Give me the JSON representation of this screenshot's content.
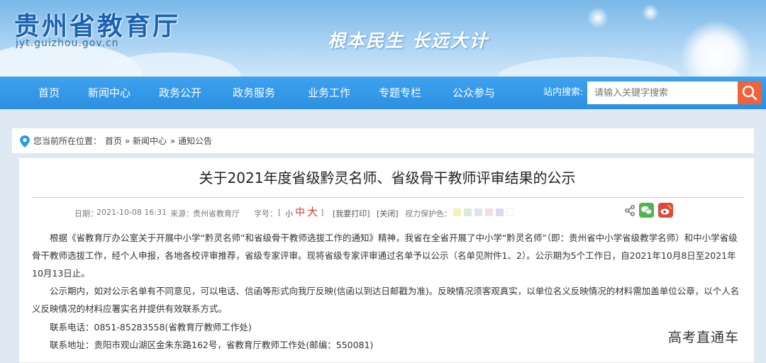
{
  "header": {
    "site_title": "贵州省教育厅",
    "site_domain": "jyt.guizhou.gov.cn",
    "slogan": "根本民生 长远大计"
  },
  "nav": {
    "items": [
      "首页",
      "新闻中心",
      "政务公开",
      "政务服务",
      "业务工作",
      "专题专栏",
      "公众参与"
    ],
    "search_label": "站内搜索:",
    "search_placeholder": "请输入关键字搜索"
  },
  "breadcrumb": {
    "label": "您当前所在位置：",
    "items": [
      "首页",
      "新闻中心",
      "通知公告"
    ],
    "separator": "»"
  },
  "article": {
    "title": "关于2021年度省级黔灵名师、省级骨干教师评审结果的公示",
    "date_label": "日期：",
    "date": "2021-10-08 16:31",
    "source_label": "来源：",
    "source": "贵州省教育厅",
    "font_label": "字号：",
    "font_open": "[",
    "font_small": "小",
    "font_medium": "中",
    "font_large": "大",
    "font_close": "]",
    "print": "[我要打印]",
    "close": "[关闭]",
    "eye_label": "视力保护色：",
    "swatch_colors": [
      "#f6f1b8",
      "#d8edd9",
      "#dfe4ea",
      "#f1dde8",
      "#e0d6ef",
      "#ffffff"
    ],
    "paragraphs": [
      "根据《省教育厅办公室关于开展中小学“黔灵名师”和省级骨干教师选拔工作的通知》精神，我省在全省开展了中小学“黔灵名师”（即：贵州省中小学省级教学名师）和中小学省级骨干教师选拔工作，经个人申报，各地各校评审推荐，省级专家评审。现将省级专家评审通过名单予以公示（名单见附件1、2）。公示期为5个工作日，自2021年10月8日至2021年10月13日止。",
      "公示期内，如对公示名单有不同意见，可以电话、信函等形式向我厅反映(信函以到达日邮戳为准)。反映情况须客观真实，以单位名义反映情况的材料需加盖单位公章，以个人名义反映情况的材料应署实名并提供有效联系方式。",
      "联系电话：0851-85283558(省教育厅教师工作处)",
      "联系地址：贵阳市观山湖区金朱东路162号，省教育厅教师工作处(邮编：550081)"
    ]
  },
  "watermark": "高考直通车",
  "colors": {
    "nav_bg": "#2c8fe2",
    "search_button": "#f0623a",
    "wechat": "#4cb84c",
    "weibo": "#e0483c",
    "title_blue": "#1a63b3"
  }
}
